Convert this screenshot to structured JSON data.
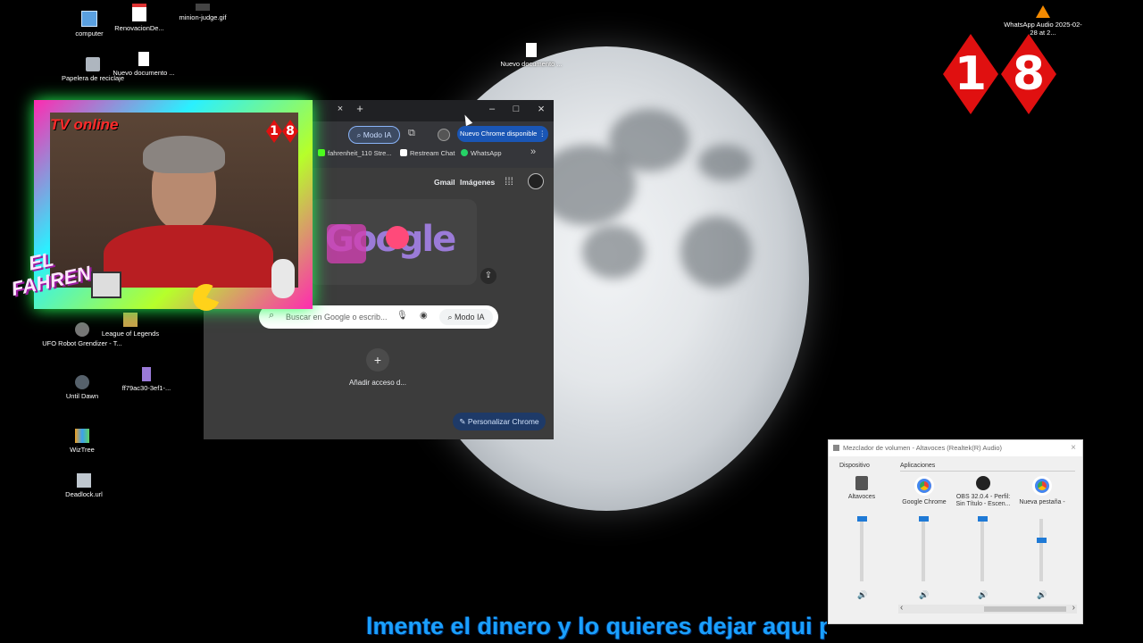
{
  "desktop": {
    "icons": [
      {
        "label": "computer"
      },
      {
        "label": "RenovacionDe..."
      },
      {
        "label": "minion-judge.gif"
      },
      {
        "label": "Papelera de reciclaje"
      },
      {
        "label": "Nuevo documento ..."
      },
      {
        "label": "Nuevo documento ..."
      },
      {
        "label": "UFO Robot Grendizer - T..."
      },
      {
        "label": "League of Legends"
      },
      {
        "label": "Until Dawn"
      },
      {
        "label": "ff79ac30-3ef1-..."
      },
      {
        "label": "WizTree"
      },
      {
        "label": "Deadlock.url"
      },
      {
        "label": "WhatsApp Audio 2025-02-28 at 2..."
      }
    ]
  },
  "chrome": {
    "tab_close": "×",
    "new_tab": "+",
    "minimize": "–",
    "maximize": "□",
    "close": "×",
    "ai_mode_label": "Modo IA",
    "update_label": "Nuevo Chrome disponible",
    "bookmarks": [
      "fahrenheit_110 Stre...",
      "Restream Chat",
      "WhatsApp"
    ],
    "overflow": "»",
    "gmail": "Gmail",
    "images": "Imágenes",
    "doodle_text": "Google",
    "search_placeholder": "Buscar en Google o escrib...",
    "search_ai_mode": "Modo IA",
    "add_shortcut_label": "Añadir acceso d...",
    "add_shortcut_symbol": "+",
    "customize_label": "Personalizar Chrome"
  },
  "overlay": {
    "tv_online": "TV online",
    "channel_name_1": "EL",
    "channel_name_2": "FAHREN",
    "badge_small": [
      "1",
      "8"
    ],
    "badge_large": [
      "1",
      "8"
    ]
  },
  "mixer": {
    "title": "Mezclador de volumen - Altavoces (Realtek(R) Audio)",
    "device_header": "Dispositivo",
    "apps_header": "Aplicaciones",
    "channels": [
      {
        "name": "Altavoces",
        "level": 1.0
      },
      {
        "name": "Google Chrome",
        "level": 1.0
      },
      {
        "name": "OBS 32.0.4 - Perfil: Sin Título - Escen...",
        "level": 1.0
      },
      {
        "name": "Nueva pestaña -",
        "level": 0.65
      }
    ],
    "scroll_left": "‹",
    "scroll_right": "›"
  },
  "subtitle": {
    "text": "lmente el dinero y lo quieres dejar aqui pa"
  },
  "colors": {
    "accent_blue": "#1f7ad6",
    "chrome_pill": "#8ab4f8",
    "subtitle": "#1aa0ff",
    "badge_red": "#e01010"
  }
}
